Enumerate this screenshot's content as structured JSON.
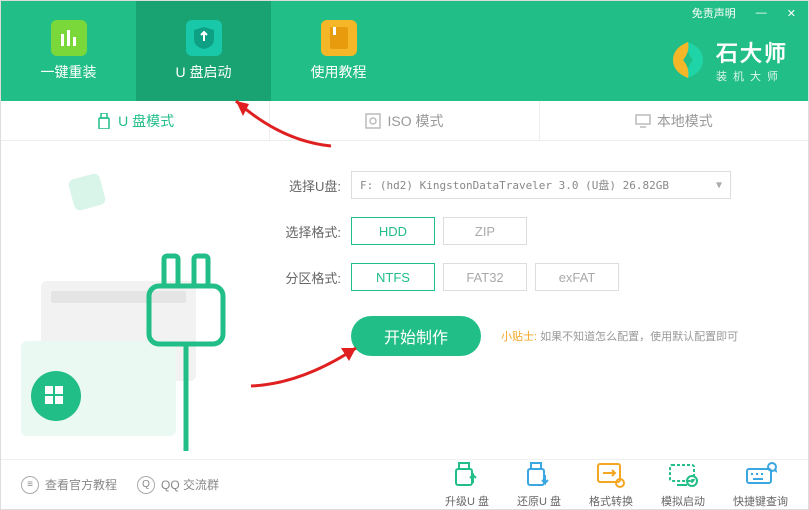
{
  "window": {
    "disclaimer": "免责声明",
    "minimize": "—",
    "close": "✕"
  },
  "brand": {
    "title": "石大师",
    "subtitle": "装机大师"
  },
  "nav": [
    {
      "label": "一键重装",
      "active": false
    },
    {
      "label": "U 盘启动",
      "active": true
    },
    {
      "label": "使用教程",
      "active": false
    }
  ],
  "mode_tabs": [
    {
      "label": "U 盘模式",
      "active": true
    },
    {
      "label": "ISO 模式",
      "active": false
    },
    {
      "label": "本地模式",
      "active": false
    }
  ],
  "form": {
    "usb_label": "选择U盘:",
    "usb_value": "F: (hd2) KingstonDataTraveler 3.0 (U盘) 26.82GB",
    "format_label": "选择格式:",
    "format_options": [
      "HDD",
      "ZIP"
    ],
    "format_selected": "HDD",
    "partition_label": "分区格式:",
    "partition_options": [
      "NTFS",
      "FAT32",
      "exFAT"
    ],
    "partition_selected": "NTFS",
    "start_button": "开始制作",
    "tip_label": "小贴士:",
    "tip_text": "如果不知道怎么配置，使用默认配置即可"
  },
  "footer_links": [
    {
      "label": "查看官方教程"
    },
    {
      "label": "QQ 交流群"
    }
  ],
  "tools": [
    {
      "label": "升级U 盘"
    },
    {
      "label": "还原U 盘"
    },
    {
      "label": "格式转换"
    },
    {
      "label": "模拟启动"
    },
    {
      "label": "快捷键查询"
    }
  ]
}
